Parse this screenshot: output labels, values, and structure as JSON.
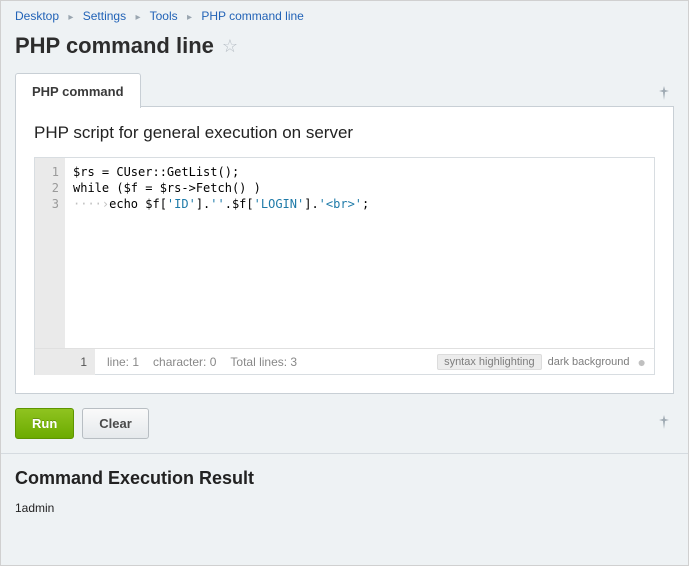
{
  "breadcrumb": {
    "items": [
      "Desktop",
      "Settings",
      "Tools",
      "PHP command line"
    ]
  },
  "page": {
    "title": "PHP command line"
  },
  "tabs": {
    "active": "PHP command"
  },
  "panel": {
    "title": "PHP script for general execution on server"
  },
  "editor": {
    "lines": {
      "n1": "1",
      "n2": "2",
      "n3": "3"
    },
    "code": {
      "l1a": "$rs = CUser::GetList();",
      "l2a": "while ($f = $rs->Fetch() )",
      "l3ws": "····›",
      "l3a": "echo $f[",
      "l3s1": "'ID'",
      "l3b": "].",
      "l3s2": "''",
      "l3c": ".$f[",
      "l3s3": "'LOGIN'",
      "l3d": "].",
      "l3s4": "'<br>'",
      "l3e": ";"
    },
    "status": {
      "curline": "1",
      "line": "line: 1",
      "char": "character: 0",
      "total": "Total lines: 3",
      "syntax": "syntax highlighting",
      "dark": "dark background"
    }
  },
  "buttons": {
    "run": "Run",
    "clear": "Clear"
  },
  "result": {
    "title": "Command Execution Result",
    "output": "1admin"
  }
}
